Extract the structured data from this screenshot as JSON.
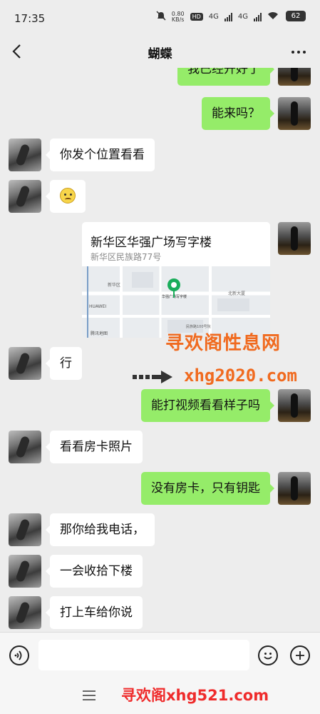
{
  "status_bar": {
    "time": "17:35",
    "speed_value": "0.80",
    "speed_unit": "KB/s",
    "hd": "HD",
    "net1": "4G",
    "net2": "4G",
    "battery": "62"
  },
  "header": {
    "title": "蝴蝶"
  },
  "messages": {
    "m0": "我已经开好了",
    "m1": "能来吗？",
    "m2": "你发个位置看看",
    "m4": "行",
    "m5": "能打视频看看样子吗",
    "m6": "看看房卡照片",
    "m7": "没有房卡，只有钥匙",
    "m8": "那你给我电话，",
    "m9": "一会收拾下楼",
    "m10": "打上车给你说"
  },
  "location_card": {
    "name": "新华区华强广场写字楼",
    "address": "新华区民族路77号",
    "map_labels": {
      "l1": "HUAWEI",
      "l2": "腾讯地图",
      "l3": "新华区",
      "l4": "华强广场写字楼",
      "l5": "北新大厦",
      "l6": "民族路100号院"
    }
  },
  "watermarks": {
    "w1": "寻欢阁性息网",
    "w2": "xhg2020.com",
    "w3": "寻欢阁xhg521.com"
  },
  "input": {
    "placeholder": ""
  },
  "colors": {
    "background": "#ededed",
    "sent_bubble": "#95ec69",
    "received_bubble": "#ffffff",
    "watermark_orange": "#f06a1f",
    "watermark_red": "#ef2b2b",
    "map_pin": "#1aad5b"
  }
}
